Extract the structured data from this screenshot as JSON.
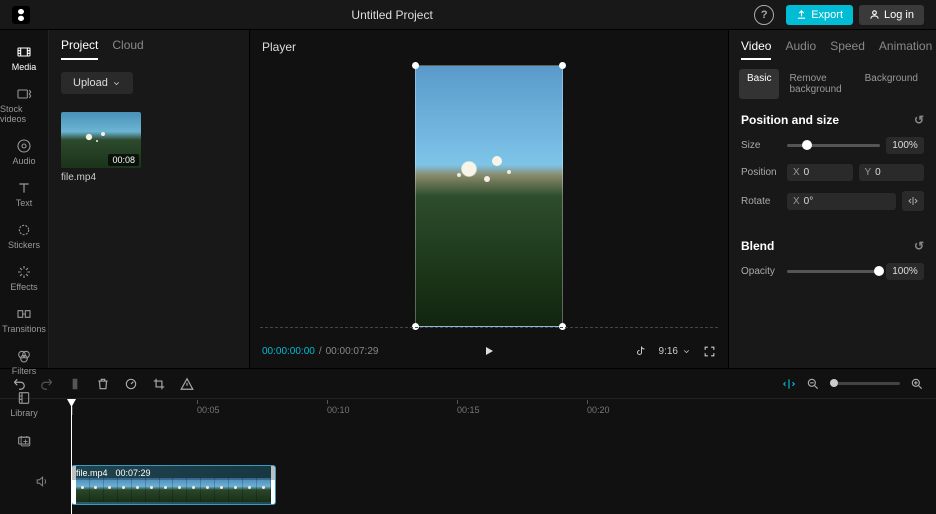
{
  "header": {
    "title": "Untitled Project",
    "help": "?",
    "export": "Export",
    "login": "Log in"
  },
  "sidebar": {
    "items": [
      {
        "label": "Media"
      },
      {
        "label": "Stock videos"
      },
      {
        "label": "Audio"
      },
      {
        "label": "Text"
      },
      {
        "label": "Stickers"
      },
      {
        "label": "Effects"
      },
      {
        "label": "Transitions"
      },
      {
        "label": "Filters"
      },
      {
        "label": "Library"
      }
    ]
  },
  "media": {
    "tabs": {
      "project": "Project",
      "cloud": "Cloud"
    },
    "upload": "Upload",
    "file": {
      "name": "file.mp4",
      "duration": "00:08"
    }
  },
  "player": {
    "title": "Player",
    "current_tc": "00:00:00:00",
    "total_tc": "00:00:07:29",
    "ratio": "9:16"
  },
  "props": {
    "tabs": {
      "video": "Video",
      "audio": "Audio",
      "speed": "Speed",
      "animation": "Animation"
    },
    "subtabs": {
      "basic": "Basic",
      "removebg": "Remove background",
      "bg": "Background"
    },
    "pos_size": "Position and size",
    "size": "Size",
    "size_val": "100%",
    "position": "Position",
    "px": "0",
    "py": "0",
    "rotate": "Rotate",
    "rot_val": "0°",
    "blend": "Blend",
    "opacity": "Opacity",
    "opacity_val": "100%",
    "x": "X",
    "y": "Y"
  },
  "ruler": {
    "m0": "|",
    "m1": "00:05",
    "m2": "00:10",
    "m3": "00:15",
    "m4": "00:20"
  },
  "clip": {
    "name": "file.mp4",
    "dur": "00:07:29"
  }
}
